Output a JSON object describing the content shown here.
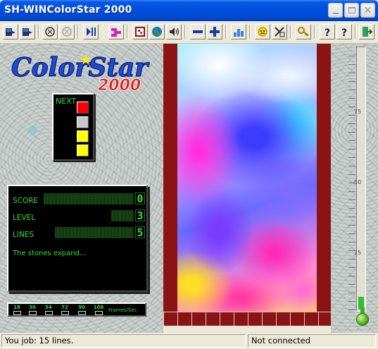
{
  "window": {
    "title": "SH-WINColorStar 2000",
    "min_label": "_",
    "max_label": "□",
    "close_label": "✕"
  },
  "toolbar": {
    "buttons": [
      "new-game-icon",
      "open-game-icon",
      "sound-icon",
      "disabled-sound-icon",
      "pause-icon",
      "level-icon",
      "board-icon",
      "network-icon",
      "volume-icon",
      "decrease-icon",
      "increase-icon",
      "high-scores-icon",
      "player-icon",
      "tools-icon",
      "key-icon",
      "help-icon",
      "context-help-icon",
      "exit-icon"
    ]
  },
  "logo": {
    "text": "ColorStar",
    "year": "2000"
  },
  "next": {
    "label": "NEXT",
    "blocks": [
      "#ff0000",
      "#c8c8c8",
      "#ffff00",
      "#ffff00"
    ]
  },
  "stats": {
    "score_label": "SCORE",
    "score_value": "0",
    "level_label": "LEVEL",
    "level_value": "3",
    "lines_label": "LINES",
    "lines_value": "5",
    "message": "The stones expand..."
  },
  "speed": {
    "options": [
      "18",
      "36",
      "54",
      "72",
      "90",
      "108"
    ],
    "unit": "Frames/Sec"
  },
  "gauge": {
    "labels": [
      "75",
      "50",
      "25"
    ],
    "level_percent": 5,
    "fill_color": "#2ec02e"
  },
  "status": {
    "left": "You job: 15 lines.",
    "right": "Not connected"
  },
  "colors": {
    "title_bar": "#0050e0",
    "lcd_green": "#2ee02e",
    "brick": "#8a1414"
  }
}
